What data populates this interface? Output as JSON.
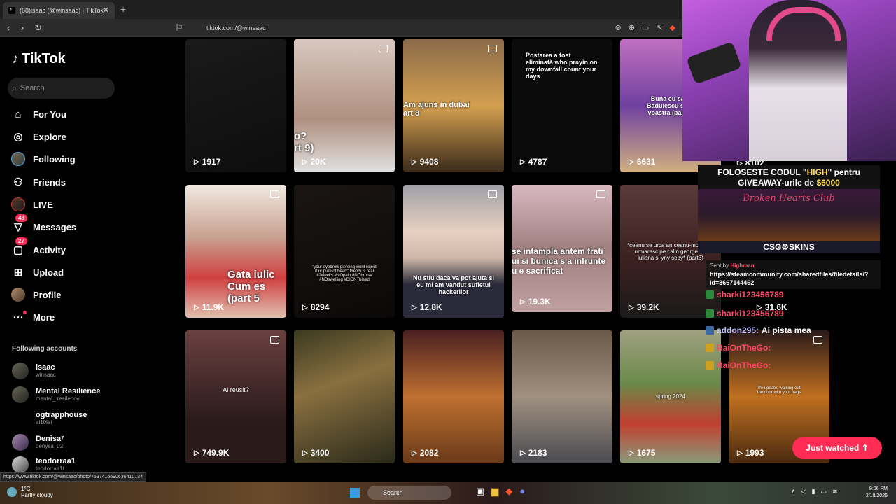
{
  "browser": {
    "tab_title": "(68)isaac (@winsaac) | TikTok",
    "tab_close": "✕",
    "new_tab": "+",
    "url": "tiktok.com/@winsaac"
  },
  "sidebar": {
    "logo": "TikTok",
    "search_placeholder": "Search",
    "nav": [
      {
        "label": "For You",
        "icon": "home-icon"
      },
      {
        "label": "Explore",
        "icon": "compass-icon"
      },
      {
        "label": "Following",
        "icon": "avatar-icon"
      },
      {
        "label": "Friends",
        "icon": "friends-icon"
      },
      {
        "label": "LIVE",
        "icon": "live-icon"
      },
      {
        "label": "Messages",
        "icon": "messages-icon",
        "badge": "48"
      },
      {
        "label": "Activity",
        "icon": "activity-icon",
        "badge": "27"
      },
      {
        "label": "Upload",
        "icon": "upload-icon"
      },
      {
        "label": "Profile",
        "icon": "profile-icon"
      },
      {
        "label": "More",
        "icon": "more-icon"
      }
    ],
    "following_title": "Following accounts",
    "following": [
      {
        "name": "isaac",
        "handle": "winsaac"
      },
      {
        "name": "Mental Resilience",
        "handle": "mental_.resilence"
      },
      {
        "name": "ogtrapphouse",
        "handle": "ai10lei"
      },
      {
        "name": "Denisa⁷",
        "handle": "denysa_02_"
      },
      {
        "name": "teodorraa1",
        "handle": "teodorraa1t"
      }
    ]
  },
  "videos": [
    {
      "views": "1917",
      "overlay": ""
    },
    {
      "views": "20K",
      "overlay": "o?\nrt 9)"
    },
    {
      "views": "9408",
      "overlay": "Am ajuns in dubai\nart 8"
    },
    {
      "views": "4787",
      "overlay": "Postarea a fost eliminată\nwho prayin on my downfall count your days"
    },
    {
      "views": "6631",
      "overlay": "Buna eu sant Badulescu si sa voastra (part 3)"
    },
    {
      "views": "8102",
      "overlay": ""
    },
    {
      "views": "11.9K",
      "overlay": "Gata iulic Cum es (part 5"
    },
    {
      "views": "8294",
      "overlay": "\"your eyebrow piercing wont reject if ur pure of heart\" theory is real #2weeks #NOpain #NObruise #NOswelling #DIDNTbleed"
    },
    {
      "views": "12.8K",
      "overlay": "Nu stiu daca va pot ajuta si eu mi am vandut sufletul hackerilor"
    },
    {
      "views": "19.3K",
      "overlay": "se intampla antem frati ui si bunica s a infrunte u e sacrificat"
    },
    {
      "views": "39.2K",
      "overlay": "*ceanu se urca an ceanu-mobil si il urmaresc pe calin georgescu iuliana si yny seby* (part3)"
    },
    {
      "views": "31.6K",
      "overlay": ""
    },
    {
      "views": "749.9K",
      "overlay": "Ai reusit?"
    },
    {
      "views": "3400",
      "overlay": ""
    },
    {
      "views": "2082",
      "overlay": ""
    },
    {
      "views": "2183",
      "overlay": ""
    },
    {
      "views": "1675",
      "overlay": "spring 2024"
    },
    {
      "views": "1993",
      "overlay": "life update: walking out the door with your bags"
    }
  ],
  "status_url": "https://www.tiktok.com/@winsaac/photo/7597416690636410134",
  "stream": {
    "promo_line1_a": "FOLOSESTE CODUL \"",
    "promo_code": "HIGH",
    "promo_line1_b": "\" pentru",
    "promo_line2_a": "GIVEAWAY-urile de ",
    "promo_amount": "$6000",
    "promo_club": "Broken Hearts Club",
    "promo_brand": "CSG⚙SKINS",
    "sent_by_label": "Sent by",
    "sent_by_name": "Highman",
    "sent_url": "https://steamcommunity.com/sharedfiles/filedetails/?id=3667144462",
    "chat": [
      {
        "name": "sharki123456789",
        "message": ""
      },
      {
        "name": "sharki123456789",
        "message": ""
      },
      {
        "name": "addon295:",
        "message": "Ai pista mea"
      },
      {
        "name": "RaiOnTheGo:",
        "message": ""
      },
      {
        "name": "RaiOnTheGo:",
        "message": ""
      }
    ]
  },
  "just_watched": "Just watched ⇑",
  "taskbar": {
    "temp": "1°C",
    "weather": "Partly cloudy",
    "search": "Search",
    "time": "9:06 PM",
    "date": "2/18/2026"
  },
  "colors": {
    "accent": "#fe2c55",
    "sidebar_bg": "#000000",
    "promo_highlight": "#ffde59"
  }
}
